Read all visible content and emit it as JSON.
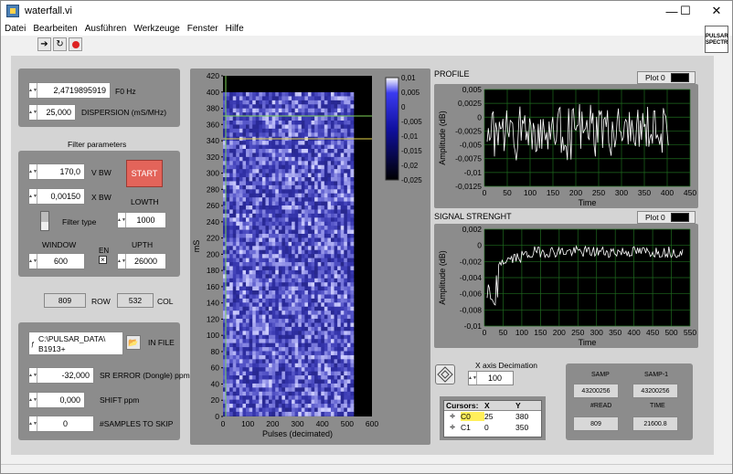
{
  "window": {
    "title": "waterfall.vi",
    "minimize": "—",
    "maximize": "☐",
    "close": "✕"
  },
  "menu": [
    "Datei",
    "Bearbeiten",
    "Ausführen",
    "Werkzeuge",
    "Fenster",
    "Hilfe"
  ],
  "corner_icon": {
    "line1": "PULSAR",
    "line2": "SPECTR"
  },
  "controls": {
    "f0": {
      "value": "2,4719895919",
      "label": "F0 Hz"
    },
    "dispersion": {
      "value": "25,000",
      "label": "DISPERSION (mS/MHz)"
    },
    "filter_title": "Filter parameters",
    "vbw": {
      "value": "170,0",
      "label": "V BW"
    },
    "xbw": {
      "value": "0,00150",
      "label": "X BW"
    },
    "start_label": "START",
    "lowth": {
      "label": "LOWTH",
      "value": "1000"
    },
    "filter_type_label": "Filter type",
    "window": {
      "label": "WINDOW",
      "value": "600"
    },
    "en_label": "EN",
    "upth": {
      "label": "UPTH",
      "value": "26000"
    },
    "row": {
      "value": "809",
      "label": "ROW"
    },
    "col": {
      "value": "532",
      "label": "COL"
    },
    "infile": {
      "line1": "C:\\PULSAR_DATA\\",
      "line2": "B1913+",
      "prefix": "ƒ",
      "label": "IN FILE"
    },
    "sr_error": {
      "value": "-32,000",
      "label": "SR ERROR (Dongle) ppm"
    },
    "shift": {
      "value": "0,000",
      "label": "SHIFT ppm"
    },
    "skip": {
      "value": "0",
      "label": "#SAMPLES TO SKIP"
    }
  },
  "waterfall": {
    "ylabel": "mS",
    "xlabel": "Pulses (decimated)",
    "yticks": [
      "420",
      "400",
      "380",
      "360",
      "340",
      "320",
      "300",
      "280",
      "260",
      "240",
      "220",
      "200",
      "180",
      "160",
      "140",
      "120",
      "100",
      "80",
      "60",
      "40",
      "20",
      "0"
    ],
    "xticks": [
      "0",
      "100",
      "200",
      "300",
      "400",
      "500",
      "600"
    ],
    "colorbar": [
      "0,01",
      "0,005",
      "0",
      "-0,005",
      "-0,01",
      "-0,015",
      "-0,02",
      "-0,025"
    ]
  },
  "profile": {
    "title": "PROFILE",
    "legend": "Plot 0",
    "ylabel": "Amplitude (dB)",
    "xlabel": "Time",
    "yticks": [
      "0,005",
      "0,0025",
      "0",
      "-0,0025",
      "-0,005",
      "-0,0075",
      "-0,01",
      "-0,0125"
    ],
    "xticks": [
      "0",
      "50",
      "100",
      "150",
      "200",
      "250",
      "300",
      "350",
      "400",
      "450"
    ]
  },
  "signal": {
    "title": "SIGNAL STRENGHT",
    "legend": "Plot 0",
    "ylabel": "Amplitude (dB)",
    "xlabel": "Time",
    "yticks": [
      "0,002",
      "0",
      "-0,002",
      "-0,004",
      "-0,006",
      "-0,008",
      "-0,01"
    ],
    "xticks": [
      "0",
      "50",
      "100",
      "150",
      "200",
      "250",
      "300",
      "350",
      "400",
      "450",
      "500",
      "550"
    ]
  },
  "decimation": {
    "label": "X axis Decimation",
    "value": "100"
  },
  "cursors": {
    "headers": [
      "Cursors:",
      "X",
      "Y"
    ],
    "rows": [
      {
        "name": "C0",
        "x": "25",
        "y": "380"
      },
      {
        "name": "C1",
        "x": "0",
        "y": "350"
      }
    ]
  },
  "stats": {
    "samp_label": "SAMP",
    "samp": "43200256",
    "samp1_label": "SAMP-1",
    "samp1": "43200256",
    "read_label": "#READ",
    "read": "809",
    "time_label": "TIME",
    "time": "21600.8"
  }
}
